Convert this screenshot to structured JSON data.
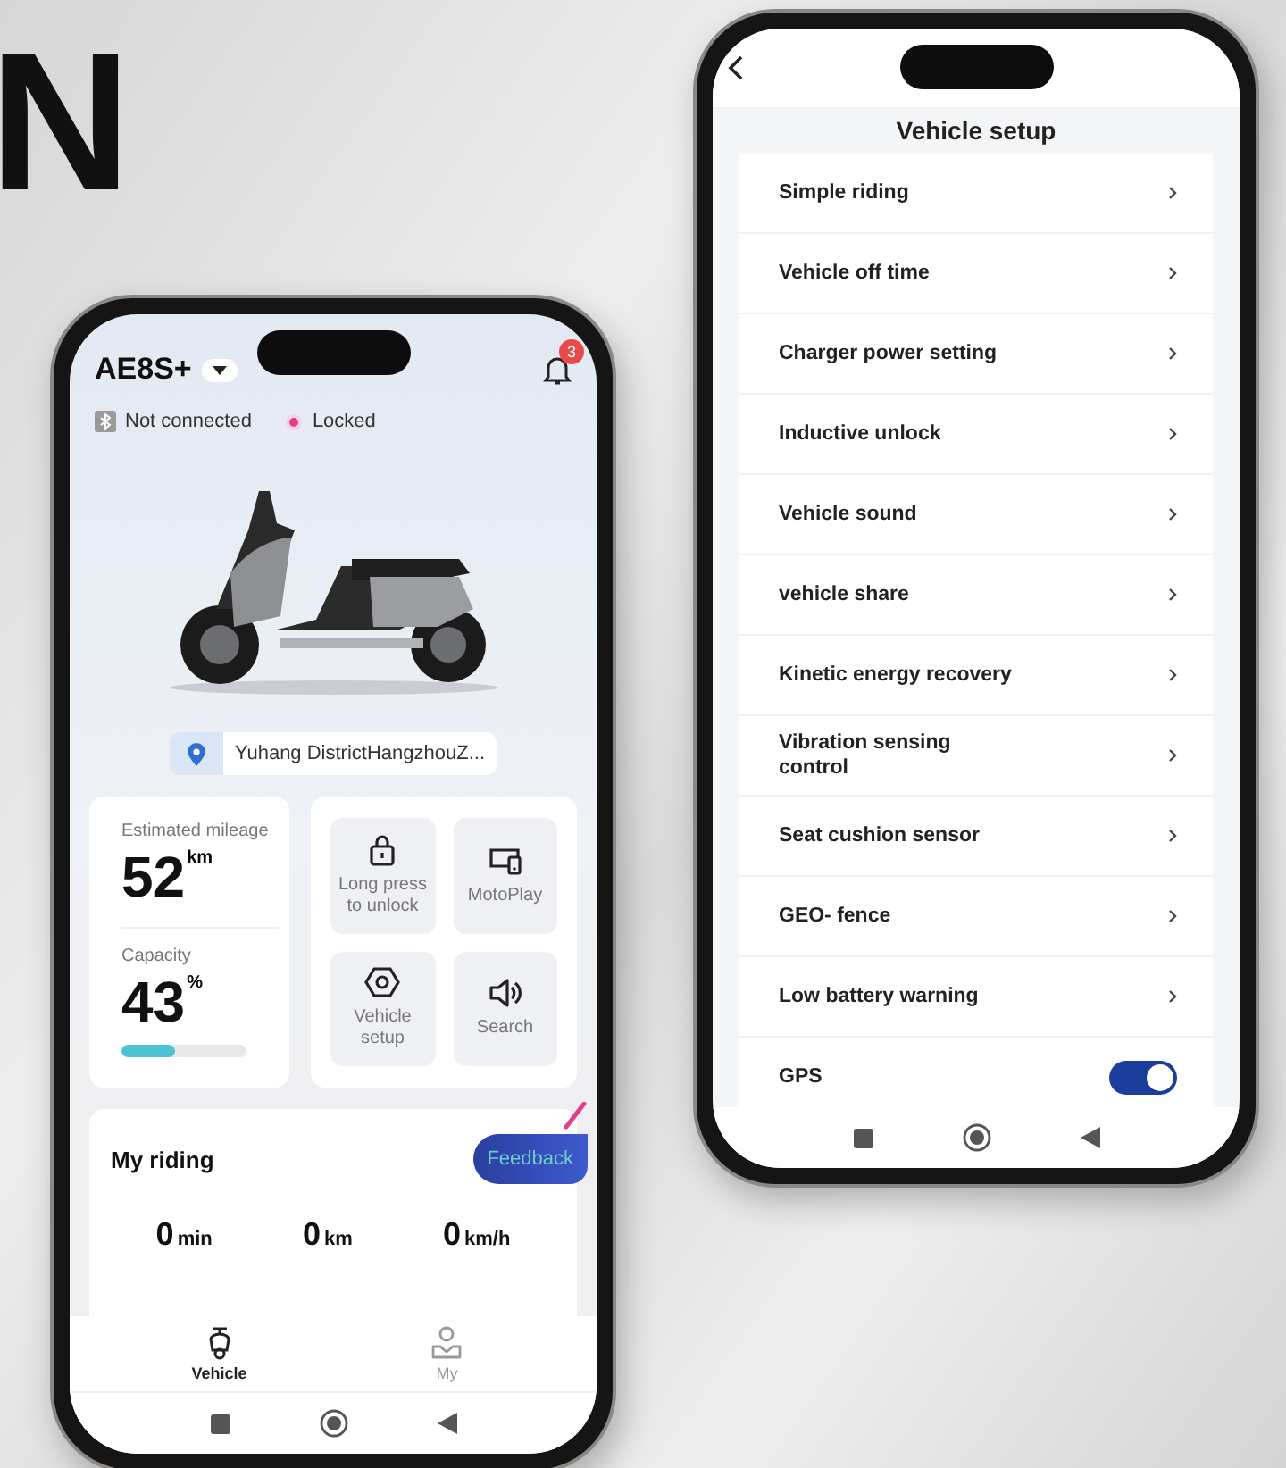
{
  "brand_mark": "N",
  "home_screen": {
    "vehicle_name": "AE8S+",
    "notification_count": "3",
    "status": [
      {
        "kind": "bluetooth",
        "label": "Not connected"
      },
      {
        "kind": "lock",
        "label": "Locked"
      }
    ],
    "location": "Yuhang DistrictHangzhouZ...",
    "mileage": {
      "label": "Estimated mileage",
      "value": "52",
      "unit": "km"
    },
    "capacity": {
      "label": "Capacity",
      "value": "43",
      "unit": "%",
      "level": 0.43
    },
    "actions": [
      {
        "kind": "lock",
        "label": "Long press to unlock"
      },
      {
        "kind": "screen",
        "label": "MotoPlay"
      },
      {
        "kind": "nut",
        "label": "Vehicle setup"
      },
      {
        "kind": "speaker",
        "label": "Search"
      }
    ],
    "my_riding": {
      "title": "My riding",
      "feedback": "Feedback",
      "metrics": [
        {
          "value": "0",
          "unit": "min"
        },
        {
          "value": "0",
          "unit": "km"
        },
        {
          "value": "0",
          "unit": "km/h"
        }
      ]
    },
    "tabs": [
      {
        "kind": "scooter",
        "label": "Vehicle",
        "selected": true
      },
      {
        "kind": "person",
        "label": "My",
        "selected": false
      }
    ]
  },
  "setup_screen": {
    "title": "Vehicle setup",
    "items": [
      {
        "kind": "link",
        "label": "Simple riding"
      },
      {
        "kind": "link",
        "label": "Vehicle off time"
      },
      {
        "kind": "link",
        "label": "Charger power setting"
      },
      {
        "kind": "link",
        "label": "Inductive unlock"
      },
      {
        "kind": "link",
        "label": "Vehicle sound"
      },
      {
        "kind": "link",
        "label": "vehicle share"
      },
      {
        "kind": "link",
        "label": "Kinetic energy recovery"
      },
      {
        "kind": "link",
        "label": "Vibration sensing\ncontrol"
      },
      {
        "kind": "link",
        "label": "Seat cushion sensor"
      },
      {
        "kind": "link",
        "label": "GEO- fence"
      },
      {
        "kind": "link",
        "label": "Low battery warning"
      },
      {
        "kind": "toggle",
        "label": "GPS",
        "on": true
      }
    ]
  }
}
